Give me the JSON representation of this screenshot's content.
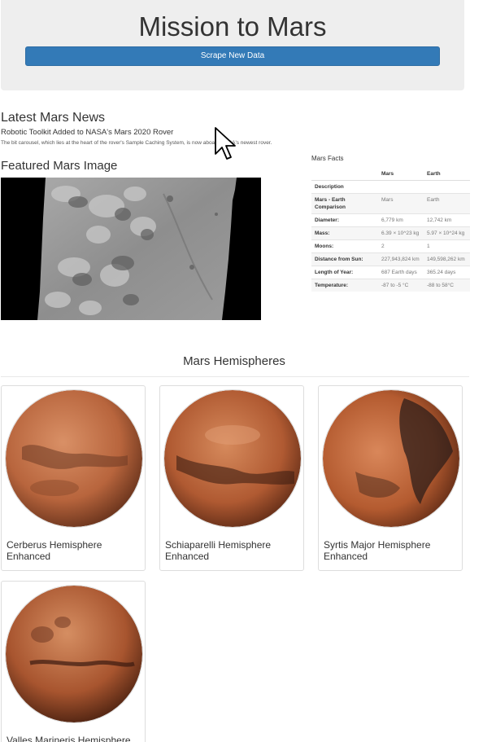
{
  "header": {
    "title": "Mission to Mars",
    "scrape_button": "Scrape New Data"
  },
  "news": {
    "heading": "Latest Mars News",
    "title": "Robotic Toolkit Added to NASA's Mars 2020 Rover",
    "paragraph": "The bit carousel, which lies at the heart of the rover's Sample Caching System, is now aboard NASA's newest rover."
  },
  "featured": {
    "heading": "Featured Mars Image"
  },
  "facts": {
    "heading": "Mars Facts",
    "col_mars": "Mars",
    "col_earth": "Earth",
    "description_label": "Description",
    "rows": [
      {
        "label": "Mars - Earth Comparison",
        "mars": "Mars",
        "earth": "Earth"
      },
      {
        "label": "Diameter:",
        "mars": "6,779 km",
        "earth": "12,742 km"
      },
      {
        "label": "Mass:",
        "mars": "6.39 × 10^23 kg",
        "earth": "5.97 × 10^24 kg"
      },
      {
        "label": "Moons:",
        "mars": "2",
        "earth": "1"
      },
      {
        "label": "Distance from Sun:",
        "mars": "227,943,824 km",
        "earth": "149,598,262 km"
      },
      {
        "label": "Length of Year:",
        "mars": "687 Earth days",
        "earth": "365.24 days"
      },
      {
        "label": "Temperature:",
        "mars": "-87 to -5 °C",
        "earth": "-88 to 58°C"
      }
    ]
  },
  "hemispheres": {
    "heading": "Mars Hemispheres",
    "items": [
      {
        "title": "Cerberus Hemisphere Enhanced"
      },
      {
        "title": "Schiaparelli Hemisphere Enhanced"
      },
      {
        "title": "Syrtis Major Hemisphere Enhanced"
      },
      {
        "title": "Valles Marineris Hemisphere Enhanced"
      }
    ]
  }
}
